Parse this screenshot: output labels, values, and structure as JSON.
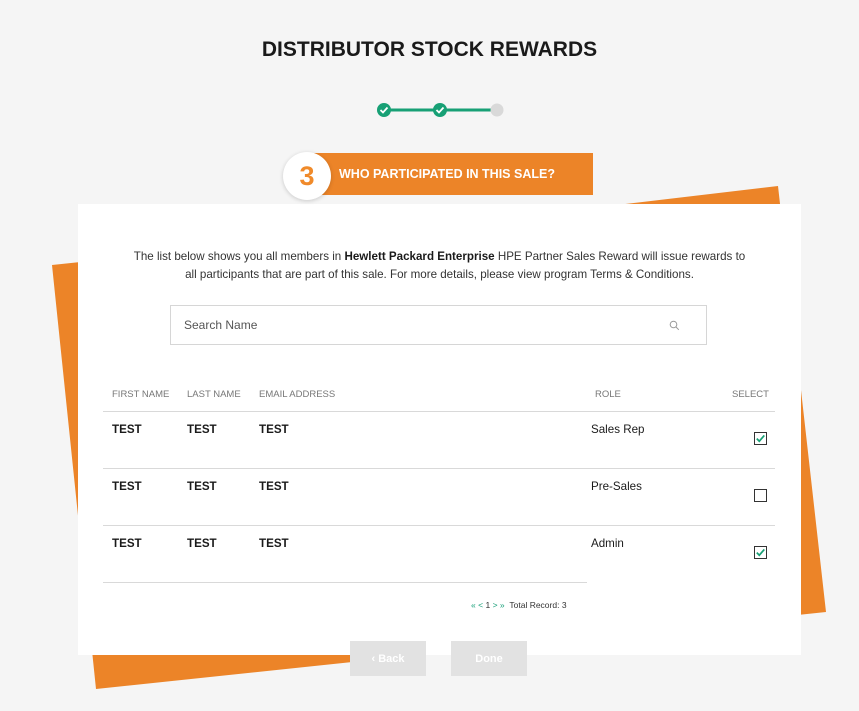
{
  "page": {
    "title": "DISTRIBUTOR STOCK REWARDS"
  },
  "progress": {
    "total_steps": 3,
    "completed_steps": 2,
    "current_step": 3,
    "colors": {
      "done": "#17a075",
      "pending": "#d9d9d9"
    }
  },
  "step": {
    "number": "3",
    "label": "WHO PARTICIPATED IN THIS SALE?"
  },
  "intro": {
    "part1": "The list below shows you all members in ",
    "company": "Hewlett Packard Enterprise",
    "part2": " HPE Partner Sales Reward will issue rewards to",
    "line2": "all participants that are part of this sale. For more details, please view program Terms & Conditions."
  },
  "search": {
    "placeholder": "Search Name",
    "icon": "search-icon"
  },
  "table": {
    "headers": {
      "first_name": "FIRST NAME",
      "last_name": "LAST NAME",
      "email": "EMAIL ADDRESS",
      "role": "ROLE",
      "select": "SELECT"
    },
    "rows": [
      {
        "first_name": "TEST",
        "last_name": "TEST",
        "email": "TEST",
        "role": "Sales Rep",
        "selected": true
      },
      {
        "first_name": "TEST",
        "last_name": "TEST",
        "email": "TEST",
        "role": "Pre-Sales",
        "selected": false
      },
      {
        "first_name": "TEST",
        "last_name": "TEST",
        "email": "TEST",
        "role": "Admin",
        "selected": true
      }
    ]
  },
  "pagination": {
    "first": "«",
    "prev": "<",
    "page": "1",
    "next": ">",
    "last": "»",
    "total_label": "Total Record: 3"
  },
  "buttons": {
    "back": "‹  Back",
    "done": "Done"
  },
  "colors": {
    "accent_orange": "#ec8428",
    "check_green": "#17a075",
    "background": "#f5f5f5"
  }
}
